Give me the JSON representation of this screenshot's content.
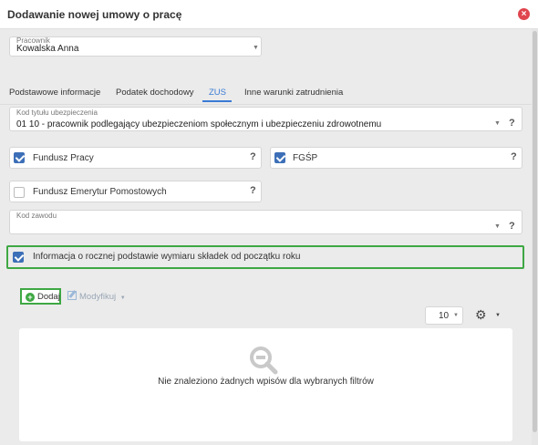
{
  "window": {
    "title": "Dodawanie nowej umowy o pracę",
    "close_icon": "close-icon"
  },
  "employee": {
    "label": "Pracownik",
    "value": "Kowalska Anna"
  },
  "tabs": [
    {
      "label": "Podstawowe informacje",
      "active": false
    },
    {
      "label": "Podatek dochodowy",
      "active": false
    },
    {
      "label": "ZUS",
      "active": true
    },
    {
      "label": "Inne warunki zatrudnienia",
      "active": false
    }
  ],
  "insurance_code": {
    "label": "Kod tytułu ubezpieczenia",
    "value": "01 10 - pracownik podlegający ubezpieczeniom społecznym i ubezpieczeniu zdrowotnemu",
    "help": "?"
  },
  "checkboxes": {
    "fundusz_pracy": {
      "label": "Fundusz Pracy",
      "checked": true,
      "help": "?"
    },
    "fgsp": {
      "label": "FGŚP",
      "checked": true,
      "help": "?"
    },
    "femp": {
      "label": "Fundusz Emerytur Pomostowych",
      "checked": false,
      "help": "?"
    },
    "annual_basis": {
      "label": "Informacja o rocznej podstawie wymiaru składek od początku roku",
      "checked": true
    }
  },
  "occupation_code": {
    "label": "Kod zawodu",
    "value": "",
    "help": "?"
  },
  "toolbar": {
    "add_label": "Dodaj",
    "modify_label": "Modyfikuj",
    "page_size": "10"
  },
  "table": {
    "empty_message": "Nie znaleziono żadnych wpisów dla wybranych filtrów"
  },
  "colors": {
    "accent": "#3a7bd5",
    "highlight": "#3ea843",
    "checkbox": "#3c6fb7",
    "close": "#e0454e"
  }
}
